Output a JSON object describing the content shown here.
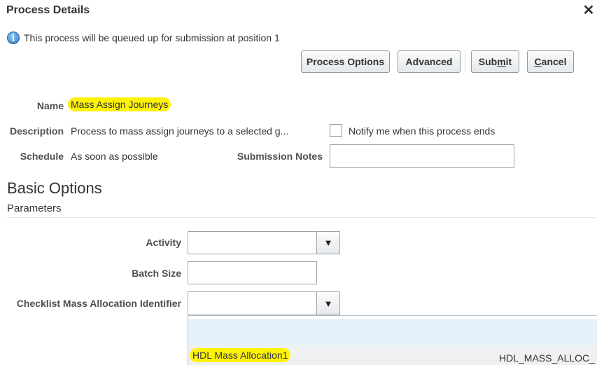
{
  "dialog": {
    "title": "Process Details",
    "close_glyph": "✕"
  },
  "info": {
    "icon": "info-icon",
    "glyph": "i",
    "message": "This process will be queued up for submission at position 1"
  },
  "toolbar": {
    "process_options_label": "Process Options",
    "advanced_label": "Advanced",
    "submit_pre": "Sub",
    "submit_key": "m",
    "submit_post": "it",
    "cancel_key": "C",
    "cancel_post": "ancel"
  },
  "details": {
    "name_label": "Name",
    "name_value": "Mass Assign Journeys",
    "description_label": "Description",
    "description_value": "Process to mass assign journeys to a selected g...",
    "notify_label": "Notify me when this process ends",
    "notify_checked": false,
    "schedule_label": "Schedule",
    "schedule_value": "As soon as possible",
    "submission_notes_label": "Submission Notes",
    "submission_notes_value": ""
  },
  "basic_options": {
    "title": "Basic Options",
    "subtitle": "Parameters",
    "activity_label": "Activity",
    "activity_value": "",
    "batch_size_label": "Batch Size",
    "batch_size_value": "",
    "checklist_label": "Checklist Mass Allocation Identifier",
    "checklist_value": ""
  },
  "dropdown": {
    "options": [
      {
        "name": "HDL Mass Allocation1",
        "code": "HDL_MASS_ALLOC_"
      }
    ]
  },
  "colors": {
    "highlight": "#fff20a",
    "info_blue": "#2c7dc7",
    "dropdown_hover": "#e6f2fb"
  }
}
